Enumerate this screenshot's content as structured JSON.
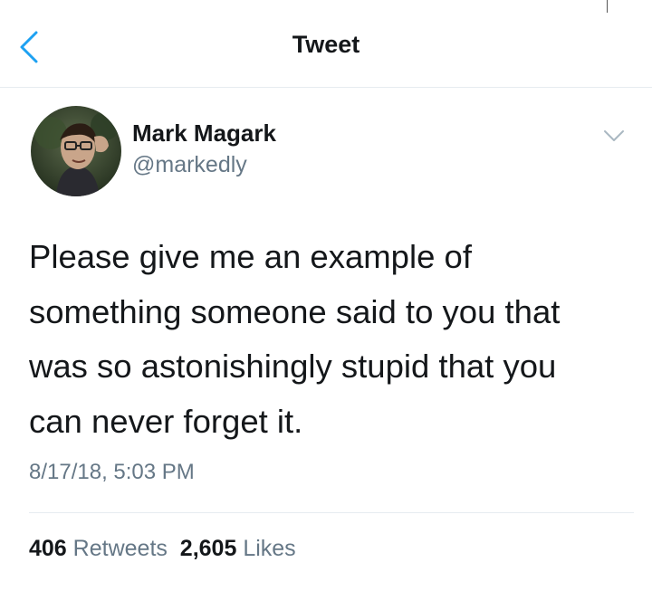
{
  "header": {
    "title": "Tweet",
    "back_icon": "chevron-left-icon"
  },
  "author": {
    "display_name": "Mark Magark",
    "handle": "@markedly",
    "avatar_icon": "avatar-photo"
  },
  "tweet": {
    "text": "Please give me an example of\nsomething someone said to you that\nwas so astonishingly stupid that you\ncan never forget it.",
    "timestamp": "8/17/18, 5:03 PM",
    "menu_icon": "chevron-down-icon"
  },
  "stats": {
    "retweets_count": "406",
    "retweets_label": "Retweets",
    "likes_count": "2,605",
    "likes_label": "Likes"
  },
  "colors": {
    "accent": "#1da1f2",
    "text": "#14171a",
    "secondary_text": "#657786",
    "divider": "#e6ecf0"
  }
}
